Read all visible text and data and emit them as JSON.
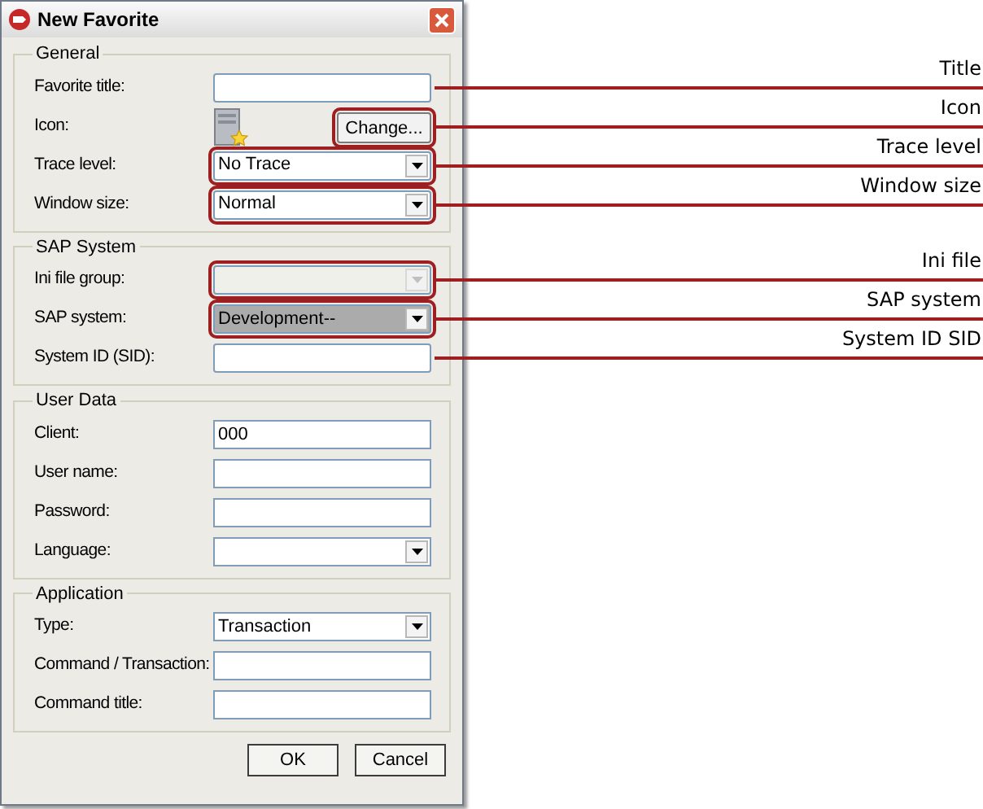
{
  "window": {
    "title": "New Favorite"
  },
  "groups": [
    {
      "title": "General",
      "fields": [
        {
          "kind": "text",
          "label": "Favorite title:",
          "disabled": false,
          "focused": false,
          "callout": "Title"
        },
        {
          "kind": "icon",
          "label": "Icon:",
          "button": "Change...",
          "disabled": false,
          "focused": false,
          "callout": "Icon"
        },
        {
          "kind": "combo",
          "label": "Trace level:",
          "value": "No Trace",
          "disabled": false,
          "focused": false,
          "callout": "Trace level"
        },
        {
          "kind": "combo",
          "label": "Window size:",
          "value": "Normal",
          "disabled": false,
          "focused": false,
          "callout": "Window size"
        }
      ]
    },
    {
      "title": "SAP System",
      "fields": [
        {
          "kind": "combo",
          "label": "Ini file group:",
          "disabled": true,
          "focused": false,
          "callout": "Ini file"
        },
        {
          "kind": "combo",
          "label": "SAP system:",
          "value": "Development--",
          "disabled": false,
          "focused": true,
          "callout": "SAP system"
        },
        {
          "kind": "text",
          "label": "System ID (SID):",
          "disabled": false,
          "focused": false,
          "callout": "System ID SID"
        }
      ]
    },
    {
      "title": "User Data",
      "fields": [
        {
          "kind": "text",
          "label": "Client:",
          "value": "000",
          "disabled": false,
          "focused": false
        },
        {
          "kind": "text",
          "label": "User name:",
          "disabled": false,
          "focused": false
        },
        {
          "kind": "text",
          "label": "Password:",
          "disabled": false,
          "focused": false
        },
        {
          "kind": "combo",
          "label": "Language:",
          "disabled": false,
          "focused": false
        }
      ]
    },
    {
      "title": "Application",
      "fields": [
        {
          "kind": "combo",
          "label": "Type:",
          "value": "Transaction",
          "disabled": false,
          "focused": false
        },
        {
          "kind": "text",
          "label": "Command / Transaction:",
          "disabled": false,
          "focused": false
        },
        {
          "kind": "text",
          "label": "Command title:",
          "disabled": false,
          "focused": false
        }
      ]
    }
  ],
  "buttons": [
    "OK",
    "Cancel"
  ]
}
